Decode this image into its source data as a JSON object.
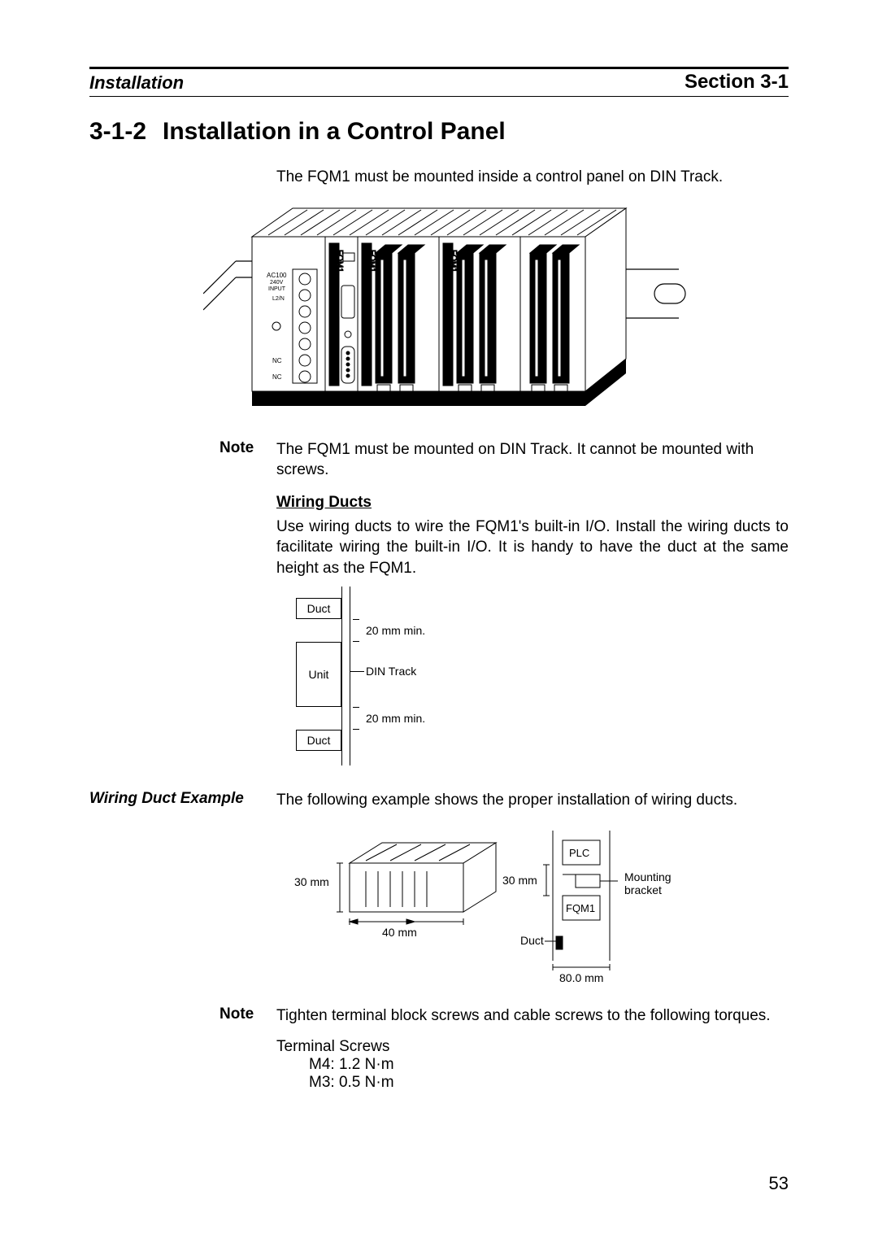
{
  "header": {
    "left": "Installation",
    "right": "Section 3-1"
  },
  "heading": {
    "number": "3-1-2",
    "title": "Installation in a Control Panel"
  },
  "intro": "The FQM1 must be mounted inside a control panel on DIN Track.",
  "fig1": {
    "module_label": "FQM1",
    "input_label_1": "AC100",
    "input_label_2": "240V",
    "input_label_3": "INPUT",
    "input_label_4": "L2/N",
    "nc": "NC"
  },
  "note1": {
    "label": "Note",
    "text": "The FQM1 must be mounted on DIN Track. It cannot be mounted with screws."
  },
  "wiring_ducts": {
    "heading": "Wiring Ducts",
    "body": "Use wiring ducts to wire the FQM1's built-in I/O. Install the wiring ducts to facilitate wiring the built-in I/O. It is handy to have the duct at the same height as the FQM1."
  },
  "fig2": {
    "duct_top": "Duct",
    "unit": "Unit",
    "duct_bottom": "Duct",
    "gap": "20 mm min.",
    "din": "DIN Track"
  },
  "wiring_example": {
    "side_heading": "Wiring Duct Example",
    "text": "The following example shows the proper installation of wiring ducts."
  },
  "fig3": {
    "left_top_dim": "30 mm",
    "left_bottom_dim": "40 mm",
    "mid_dim": "30 mm",
    "plc": "PLC",
    "fqm1": "FQM1",
    "duct": "Duct",
    "mounting": "Mounting\nbracket",
    "bottom_dim": "80.0 mm"
  },
  "note2": {
    "label": "Note",
    "text": "Tighten terminal block screws and cable screws to the following torques."
  },
  "torque": {
    "title": "Terminal Screws",
    "m4": "M4:  1.2 N·m",
    "m3": "M3:  0.5 N·m"
  },
  "page_number": "53"
}
